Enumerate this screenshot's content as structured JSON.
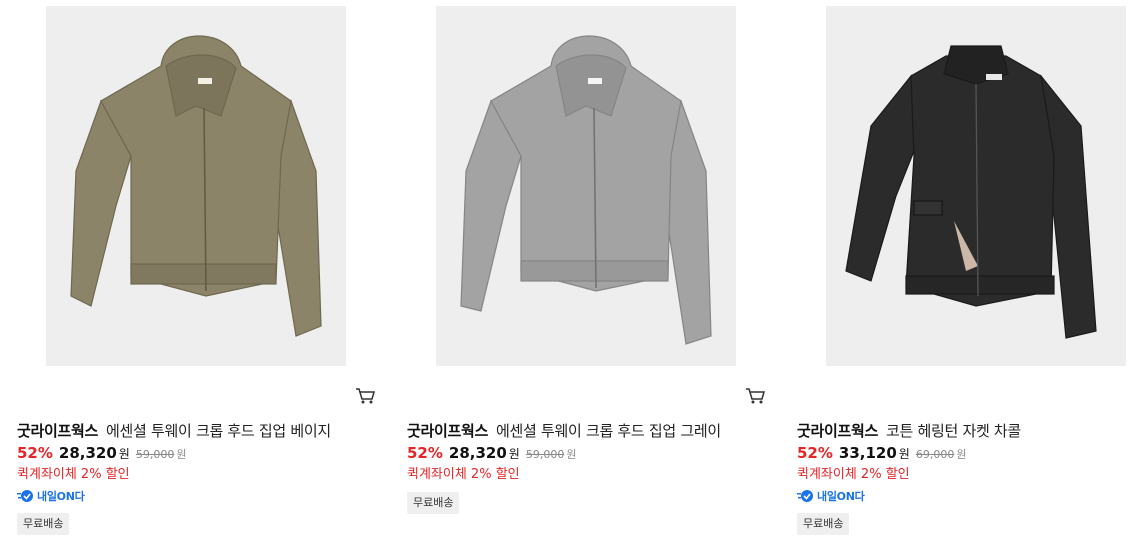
{
  "products": [
    {
      "brand": "굿라이프웍스",
      "name": "에센셜 투웨이 크롭 후드 집업 베이지",
      "discount": "52%",
      "price": "28,320",
      "currency": "원",
      "original_price": "59,000",
      "promo": "퀵계좌이체 2% 할인",
      "delivery_badge": "내일ON다",
      "shipping": "무료배송",
      "image_icon": "beige-hood-zipup-image",
      "garment_color": "#8c8468"
    },
    {
      "brand": "굿라이프웍스",
      "name": "에센셜 투웨이 크롭 후드 집업 그레이",
      "discount": "52%",
      "price": "28,320",
      "currency": "원",
      "original_price": "59,000",
      "promo": "퀵계좌이체 2% 할인",
      "delivery_badge": "",
      "shipping": "무료배송",
      "image_icon": "gray-hood-zipup-image",
      "garment_color": "#9d9d9d"
    },
    {
      "brand": "굿라이프웍스",
      "name": "코튼 헤링턴 자켓 차콜",
      "discount": "52%",
      "price": "33,120",
      "currency": "원",
      "original_price": "69,000",
      "promo": "퀵계좌이체 2% 할인",
      "delivery_badge": "내일ON다",
      "shipping": "무료배송",
      "image_icon": "charcoal-harrington-jacket-image",
      "garment_color": "#2b2b2b"
    }
  ],
  "colors": {
    "accent_red": "#e52528",
    "badge_blue": "#1a73e8",
    "thumb_bg": "#eeeeee"
  }
}
